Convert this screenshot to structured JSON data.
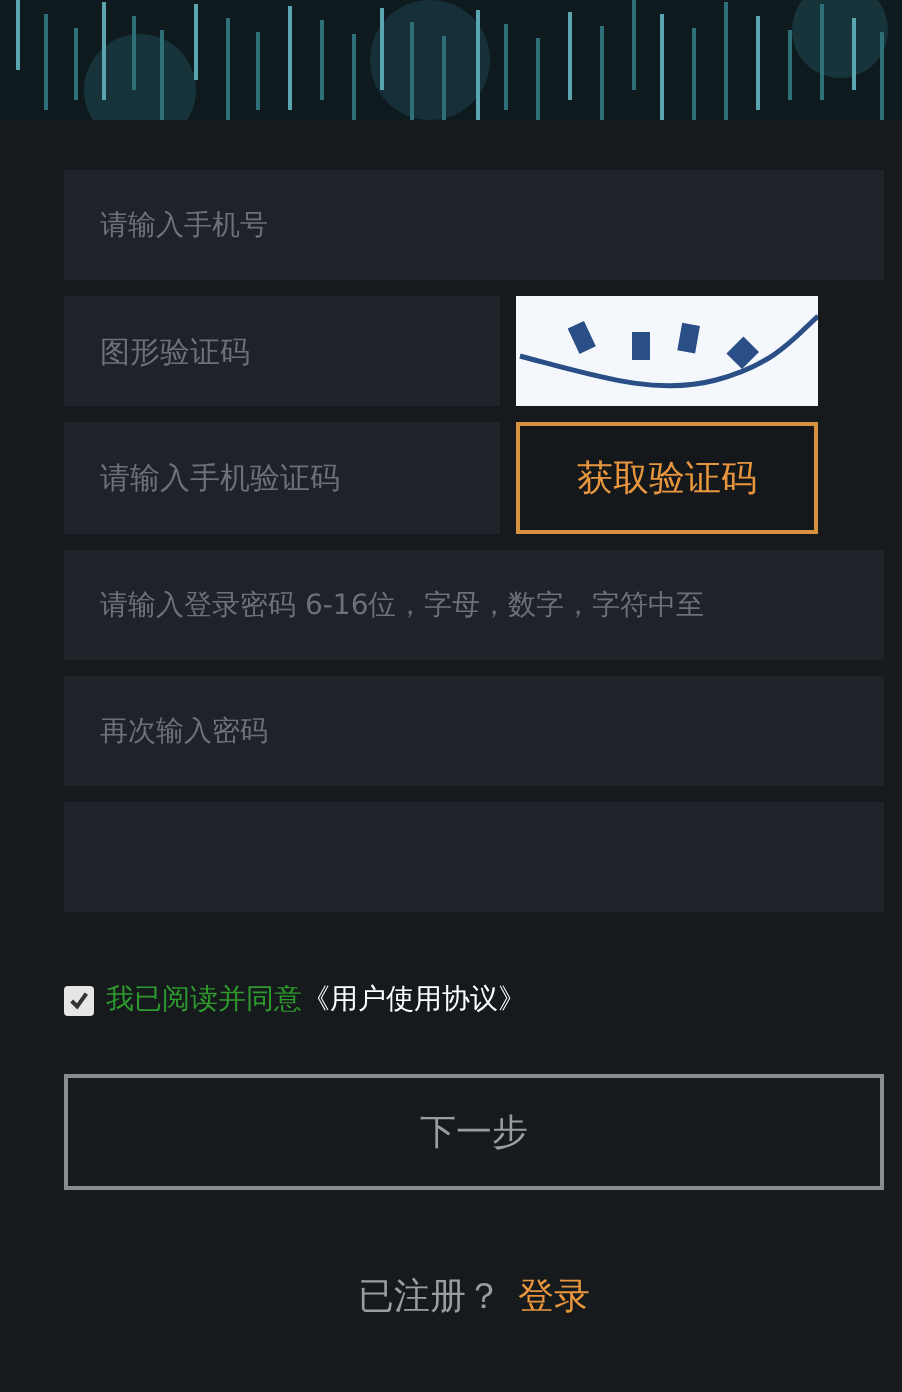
{
  "fields": [
    {
      "kind": "input",
      "placeholder": "请输入手机号"
    },
    {
      "kind": "captcha",
      "placeholder": "图形验证码"
    },
    {
      "kind": "sms",
      "placeholder": "请输入手机验证码",
      "button": "获取验证码"
    },
    {
      "kind": "input",
      "placeholder": "请输入登录密码 6-16位，字母，数字，字符中至"
    },
    {
      "kind": "input",
      "placeholder": "再次输入密码"
    },
    {
      "kind": "input"
    }
  ],
  "agreement": {
    "checked": true,
    "text": "我已阅读并同意",
    "link": "《用户使用协议》"
  },
  "next_button": "下一步",
  "footer": {
    "text": "已注册？",
    "link": "登录"
  }
}
